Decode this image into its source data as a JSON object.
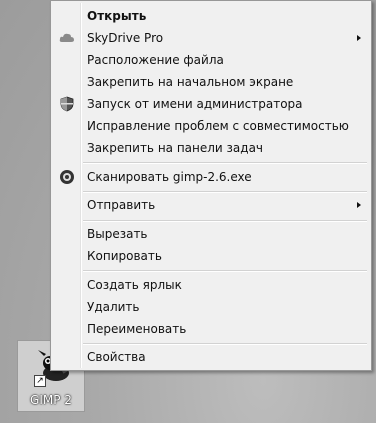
{
  "desktop": {
    "icon_label": "GIMP 2"
  },
  "menu": {
    "open": "Открыть",
    "skydrive": "SkyDrive Pro",
    "file_location": "Расположение файла",
    "pin_start": "Закрепить на начальном экране",
    "run_admin": "Запуск от имени администратора",
    "troubleshoot": "Исправление проблем с совместимостью",
    "pin_taskbar": "Закрепить на панели задач",
    "scan": "Сканировать gimp-2.6.exe",
    "send_to": "Отправить",
    "cut": "Вырезать",
    "copy": "Копировать",
    "create_shortcut": "Создать ярлык",
    "delete": "Удалить",
    "rename": "Переименовать",
    "properties": "Свойства"
  },
  "icons": {
    "skydrive": "cloud-icon",
    "run_admin": "uac-shield-icon",
    "scan": "antivirus-icon",
    "desktop": "gimp-wilber-icon"
  }
}
